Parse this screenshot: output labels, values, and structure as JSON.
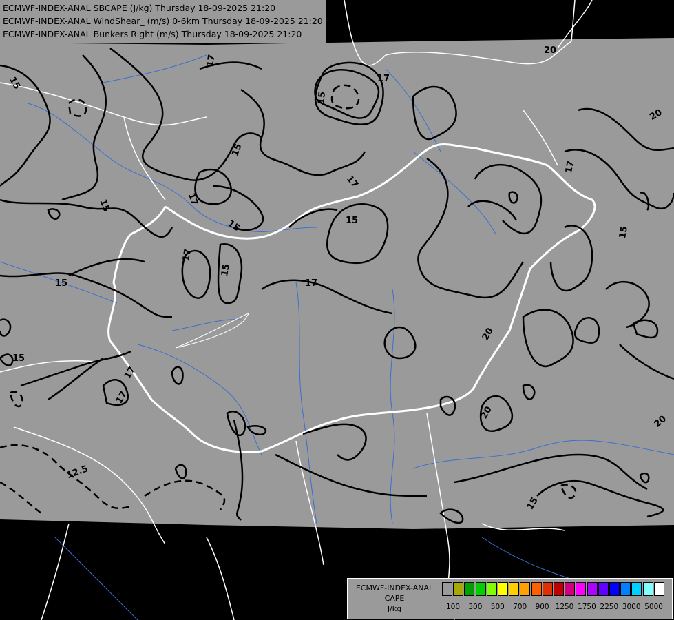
{
  "header": {
    "line1": "ECMWF-INDEX-ANAL SBCAPE (J/kg) Thursday 18-09-2025 21:20",
    "line2": "ECMWF-INDEX-ANAL WindShear_ (m/s) 0-6km Thursday 18-09-2025 21:20",
    "line3": "ECMWF-INDEX-ANAL Bunkers Right (m/s) Thursday 18-09-2025 21:20"
  },
  "colors": {
    "background": "#000000",
    "domain_fill": "#9a9a9a",
    "borders": "#ffffff",
    "rivers": "#3a6fd0",
    "contours": "#000000"
  },
  "contour_labels": [
    "12.5",
    "15",
    "17",
    "20"
  ],
  "legend": {
    "title_line1": "ECMWF-INDEX-ANAL",
    "title_line2": "CAPE",
    "title_line3": "J/kg",
    "swatches": [
      "#9a9a9a",
      "#a8a800",
      "#00a000",
      "#00d000",
      "#80ff00",
      "#ffff00",
      "#ffd000",
      "#ffa000",
      "#ff6000",
      "#e03000",
      "#c00000",
      "#d00080",
      "#ff00ff",
      "#b000ff",
      "#6000ff",
      "#0000ff",
      "#0080ff",
      "#00d0ff",
      "#80ffff",
      "#ffffff"
    ],
    "ticks": [
      "100",
      "300",
      "500",
      "700",
      "900",
      "1250",
      "1750",
      "2250",
      "3000",
      "5000"
    ]
  }
}
